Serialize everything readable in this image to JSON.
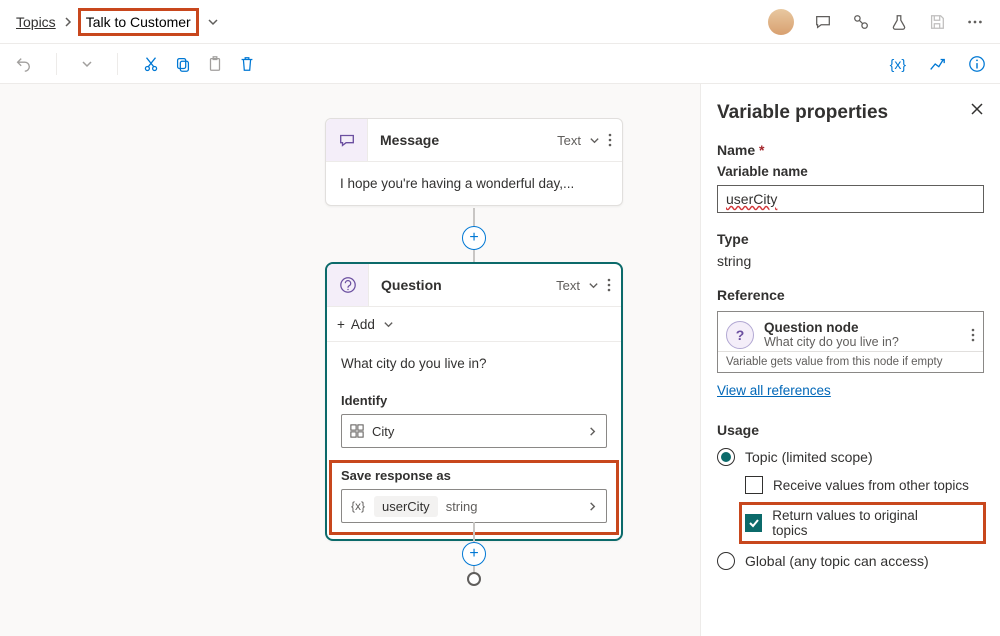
{
  "breadcrumb": {
    "root": "Topics",
    "current": "Talk to Customer"
  },
  "canvas": {
    "message": {
      "title": "Message",
      "format": "Text",
      "body": "I hope you're having a wonderful day,..."
    },
    "question": {
      "title": "Question",
      "format": "Text",
      "add": "Add",
      "prompt": "What city do you live in?",
      "identify_label": "Identify",
      "identify_value": "City",
      "save_label": "Save response as",
      "var_name": "userCity",
      "var_type": "string"
    }
  },
  "panel": {
    "title": "Variable properties",
    "name_label": "Name",
    "name_sub": "Variable name",
    "name_value": "userCity",
    "type_label": "Type",
    "type_value": "string",
    "ref_label": "Reference",
    "ref_node_title": "Question node",
    "ref_node_sub": "What city do you live in?",
    "ref_note": "Variable gets value from this node if empty",
    "view_all": "View all references",
    "usage_label": "Usage",
    "usage_topic": "Topic (limited scope)",
    "usage_receive": "Receive values from other topics",
    "usage_return": "Return values to original topics",
    "usage_global": "Global (any topic can access)"
  }
}
